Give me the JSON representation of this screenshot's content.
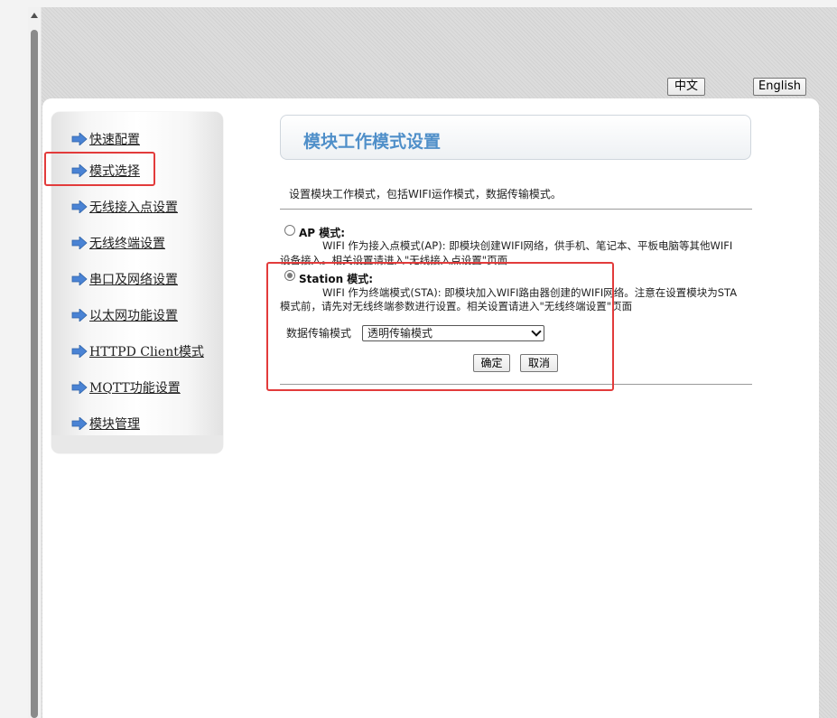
{
  "lang": {
    "zh": "中文",
    "en": "English"
  },
  "sidebar": {
    "items": [
      {
        "label": "快速配置"
      },
      {
        "label": "模式选择"
      },
      {
        "label": "无线接入点设置"
      },
      {
        "label": "无线终端设置"
      },
      {
        "label": "串口及网络设置"
      },
      {
        "label": "以太网功能设置"
      },
      {
        "label": "HTTPD Client模式"
      },
      {
        "label": "MQTT功能设置"
      },
      {
        "label": "模块管理"
      }
    ]
  },
  "main": {
    "title": "模块工作模式设置",
    "description": "设置模块工作模式，包括WIFI运作模式，数据传输模式。",
    "ap": {
      "label": "AP 模式:",
      "text_line1": "WIFI 作为接入点模式(AP): 即模块创建WIFI网络，供手机、笔记本、平板电脑等其他WIFI",
      "text_line2": "设备接入。相关设置请进入\"无线接入点设置\"页面"
    },
    "station": {
      "label": "Station 模式:",
      "text_line1": "WIFI 作为终端模式(STA): 即模块加入WIFI路由器创建的WIFI网络。注意在设置模块为STA",
      "text_line2": "模式前，请先对无线终端参数进行设置。相关设置请进入\"无线终端设置\"页面"
    },
    "transfer": {
      "label": "数据传输模式",
      "selected": "透明传输模式"
    },
    "ok_label": "确定",
    "cancel_label": "取消"
  },
  "colors": {
    "accent": "#4f8fc9",
    "arrow": "#4a83d4",
    "highlight": "#e23b3b"
  }
}
